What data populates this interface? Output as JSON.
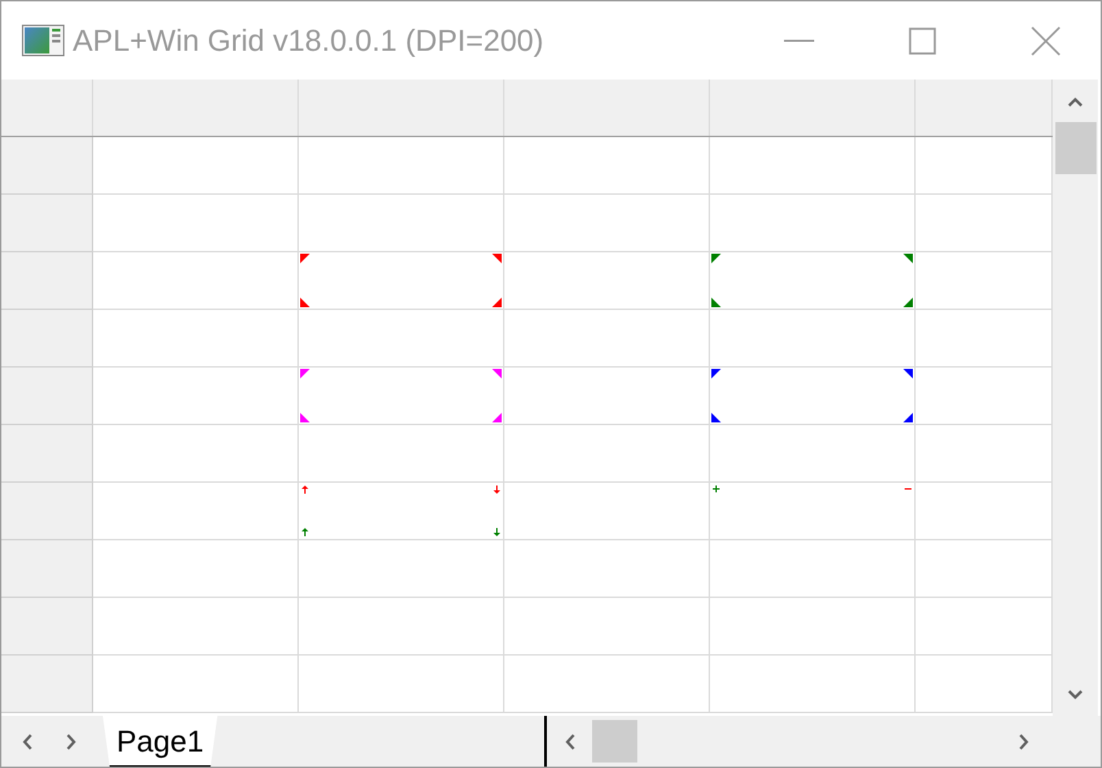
{
  "window": {
    "title": "APL+Win Grid v18.0.0.1 (DPI=200)"
  },
  "grid": {
    "rows": [
      [
        {
          "kind": "plain"
        },
        {
          "kind": "plain"
        },
        {
          "kind": "plain"
        },
        {
          "kind": "plain"
        },
        {
          "kind": "plain"
        }
      ],
      [
        {
          "kind": "plain"
        },
        {
          "kind": "plain"
        },
        {
          "kind": "plain"
        },
        {
          "kind": "plain"
        },
        {
          "kind": "plain"
        }
      ],
      [
        {
          "kind": "plain"
        },
        {
          "kind": "marked",
          "markers": [
            {
              "kind": "triangle",
              "color": "#ff0000"
            },
            {
              "kind": "triangle",
              "color": "#ff0000"
            },
            {
              "kind": "triangle",
              "color": "#ff0000"
            },
            {
              "kind": "triangle",
              "color": "#ff0000"
            }
          ]
        },
        {
          "kind": "plain"
        },
        {
          "kind": "marked",
          "markers": [
            {
              "kind": "triangle",
              "color": "#008000"
            },
            {
              "kind": "triangle",
              "color": "#008000"
            },
            {
              "kind": "triangle",
              "color": "#008000"
            },
            {
              "kind": "triangle",
              "color": "#008000"
            }
          ]
        },
        {
          "kind": "plain"
        }
      ],
      [
        {
          "kind": "plain"
        },
        {
          "kind": "plain"
        },
        {
          "kind": "plain"
        },
        {
          "kind": "plain"
        },
        {
          "kind": "plain"
        }
      ],
      [
        {
          "kind": "plain"
        },
        {
          "kind": "marked",
          "markers": [
            {
              "kind": "triangle",
              "color": "#ff00ff"
            },
            {
              "kind": "triangle",
              "color": "#ff00ff"
            },
            {
              "kind": "triangle",
              "color": "#ff00ff"
            },
            {
              "kind": "triangle",
              "color": "#ff00ff"
            }
          ]
        },
        {
          "kind": "plain"
        },
        {
          "kind": "marked",
          "markers": [
            {
              "kind": "triangle",
              "color": "#0000ff"
            },
            {
              "kind": "triangle",
              "color": "#0000ff"
            },
            {
              "kind": "triangle",
              "color": "#0000ff"
            },
            {
              "kind": "triangle",
              "color": "#0000ff"
            }
          ]
        },
        {
          "kind": "plain"
        }
      ],
      [
        {
          "kind": "plain"
        },
        {
          "kind": "plain"
        },
        {
          "kind": "plain"
        },
        {
          "kind": "plain"
        },
        {
          "kind": "plain"
        }
      ],
      [
        {
          "kind": "plain"
        },
        {
          "kind": "marked",
          "markers": [
            {
              "kind": "arrow-up",
              "color": "#ff0000"
            },
            {
              "kind": "arrow-down",
              "color": "#ff0000"
            },
            {
              "kind": "arrow-up",
              "color": "#008000"
            },
            {
              "kind": "arrow-down",
              "color": "#008000"
            }
          ]
        },
        {
          "kind": "plain"
        },
        {
          "kind": "marked",
          "markers": [
            {
              "kind": "plus",
              "color": "#008000"
            },
            {
              "kind": "minus",
              "color": "#ff0000"
            }
          ]
        },
        {
          "kind": "plain"
        }
      ],
      [
        {
          "kind": "plain"
        },
        {
          "kind": "plain"
        },
        {
          "kind": "plain"
        },
        {
          "kind": "plain"
        },
        {
          "kind": "plain"
        }
      ],
      [
        {
          "kind": "plain"
        },
        {
          "kind": "plain"
        },
        {
          "kind": "plain"
        },
        {
          "kind": "plain"
        },
        {
          "kind": "plain"
        }
      ],
      [
        {
          "kind": "plain"
        },
        {
          "kind": "plain"
        },
        {
          "kind": "plain"
        },
        {
          "kind": "plain"
        },
        {
          "kind": "plain"
        }
      ]
    ]
  },
  "sheet_tabs": [
    {
      "label": "Page1",
      "selected": true
    }
  ]
}
